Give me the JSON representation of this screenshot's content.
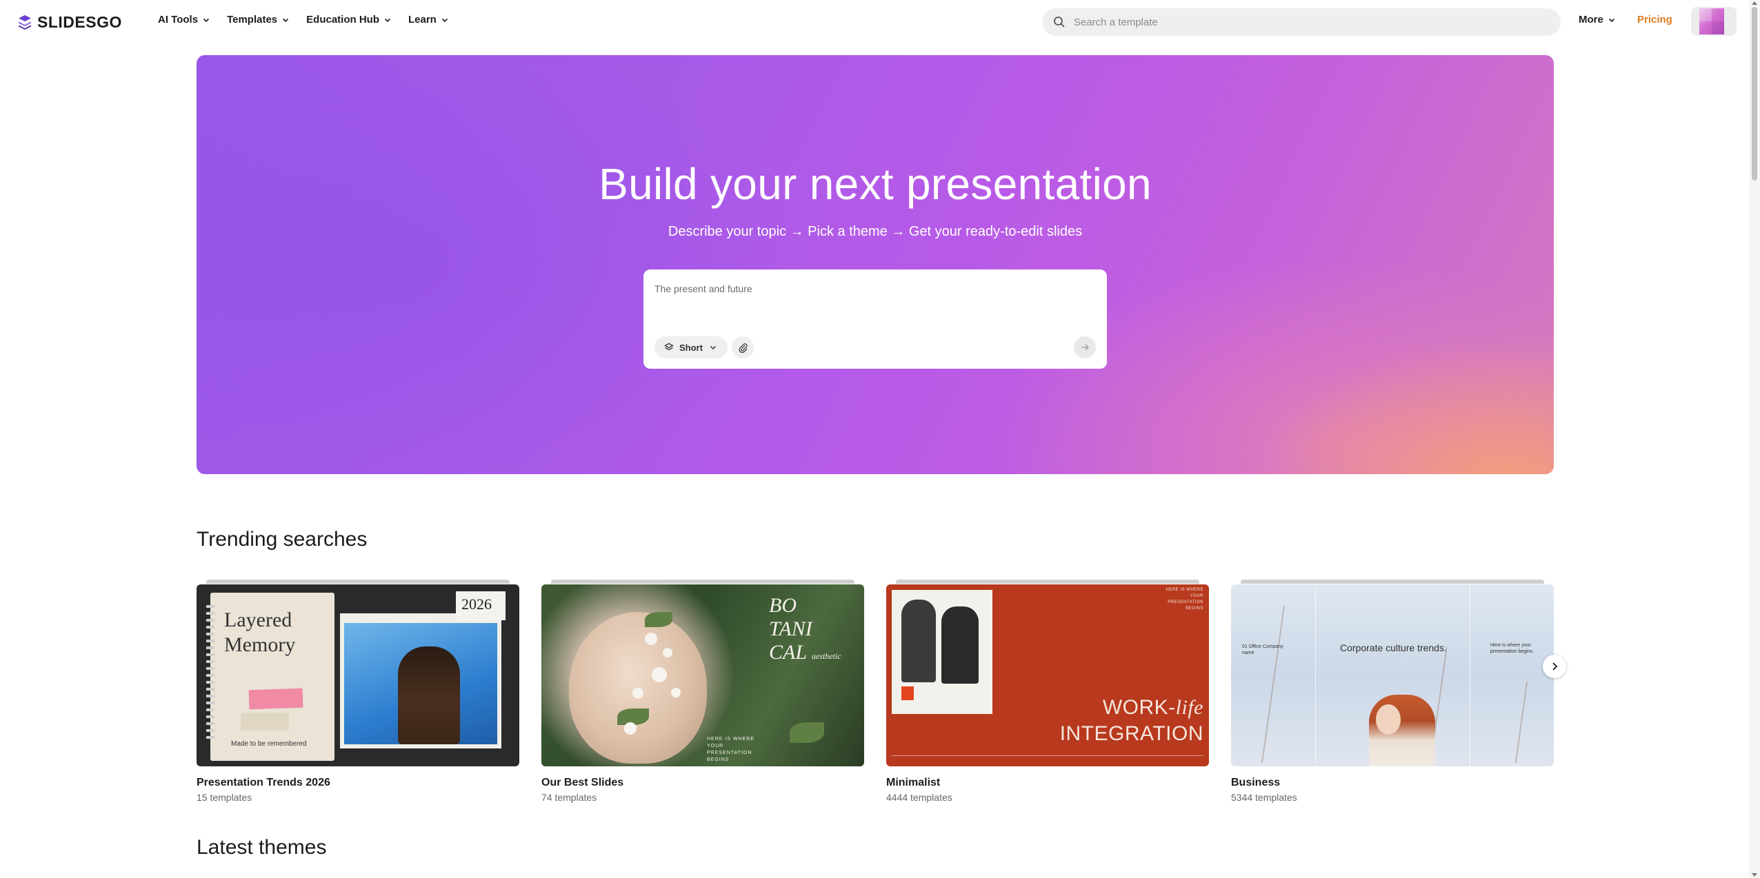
{
  "brand": {
    "name": "SLIDESGO",
    "accent": "#6b3fcf"
  },
  "nav": {
    "items": [
      {
        "label": "AI Tools",
        "icon": "chevron-down-icon"
      },
      {
        "label": "Templates",
        "icon": "chevron-down-icon"
      },
      {
        "label": "Education Hub",
        "icon": "chevron-down-icon"
      },
      {
        "label": "Learn",
        "icon": "chevron-down-icon"
      }
    ],
    "search_placeholder": "Search a template",
    "more_label": "More",
    "pricing_label": "Pricing",
    "pricing_color": "#e07b20"
  },
  "hero": {
    "title": "Build your next presentation",
    "subtitle": "Describe your topic → Pick a theme → Get your ready-to-edit slides",
    "prompt_text": "The present and future",
    "length_option": "Short",
    "gradient_colors": [
      "#9a57e8",
      "#c661dc",
      "#f6a078"
    ]
  },
  "trending": {
    "title": "Trending searches",
    "cards": [
      {
        "name": "Presentation Trends 2026",
        "count": "15 templates",
        "thumb_text": [
          "Layered",
          "Memory"
        ],
        "thumb_caption": "Made to be remembered",
        "thumb_badge": "2026"
      },
      {
        "name": "Our Best Slides",
        "count": "74 templates",
        "thumb_text": [
          "BO",
          "TANI",
          "CAL"
        ],
        "thumb_sub": "aesthetic",
        "thumb_small": "HERE IS WHERE YOUR PRESENTATION BEGINS"
      },
      {
        "name": "Minimalist",
        "count": "4444 templates",
        "thumb_text": [
          "WORK-",
          "life",
          "INTEGRATION"
        ],
        "thumb_small": "HERE IS WHERE YOUR PRESENTATION BEGINS"
      },
      {
        "name": "Business",
        "count": "5344 templates",
        "thumb_text": [
          "Corporate culture trends."
        ],
        "thumb_small_left": "01 Office Company name",
        "thumb_small_right": "Here is where your presentation begins."
      }
    ]
  },
  "latest": {
    "title": "Latest themes"
  }
}
